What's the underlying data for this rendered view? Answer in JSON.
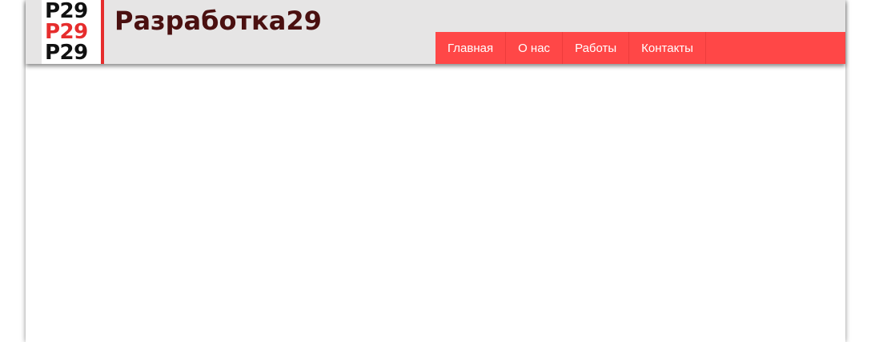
{
  "site": {
    "logo_lines": [
      "P29",
      "P29",
      "P29"
    ],
    "title": "Разработка29"
  },
  "nav": {
    "items": [
      {
        "label": "Главная"
      },
      {
        "label": "О нас"
      },
      {
        "label": "Работы"
      },
      {
        "label": "Контакты"
      }
    ]
  },
  "colors": {
    "header_bg": "#e6e5e5",
    "nav_bg": "#ff4747",
    "accent_red": "#e62d2d",
    "title_text": "#4a1010"
  }
}
